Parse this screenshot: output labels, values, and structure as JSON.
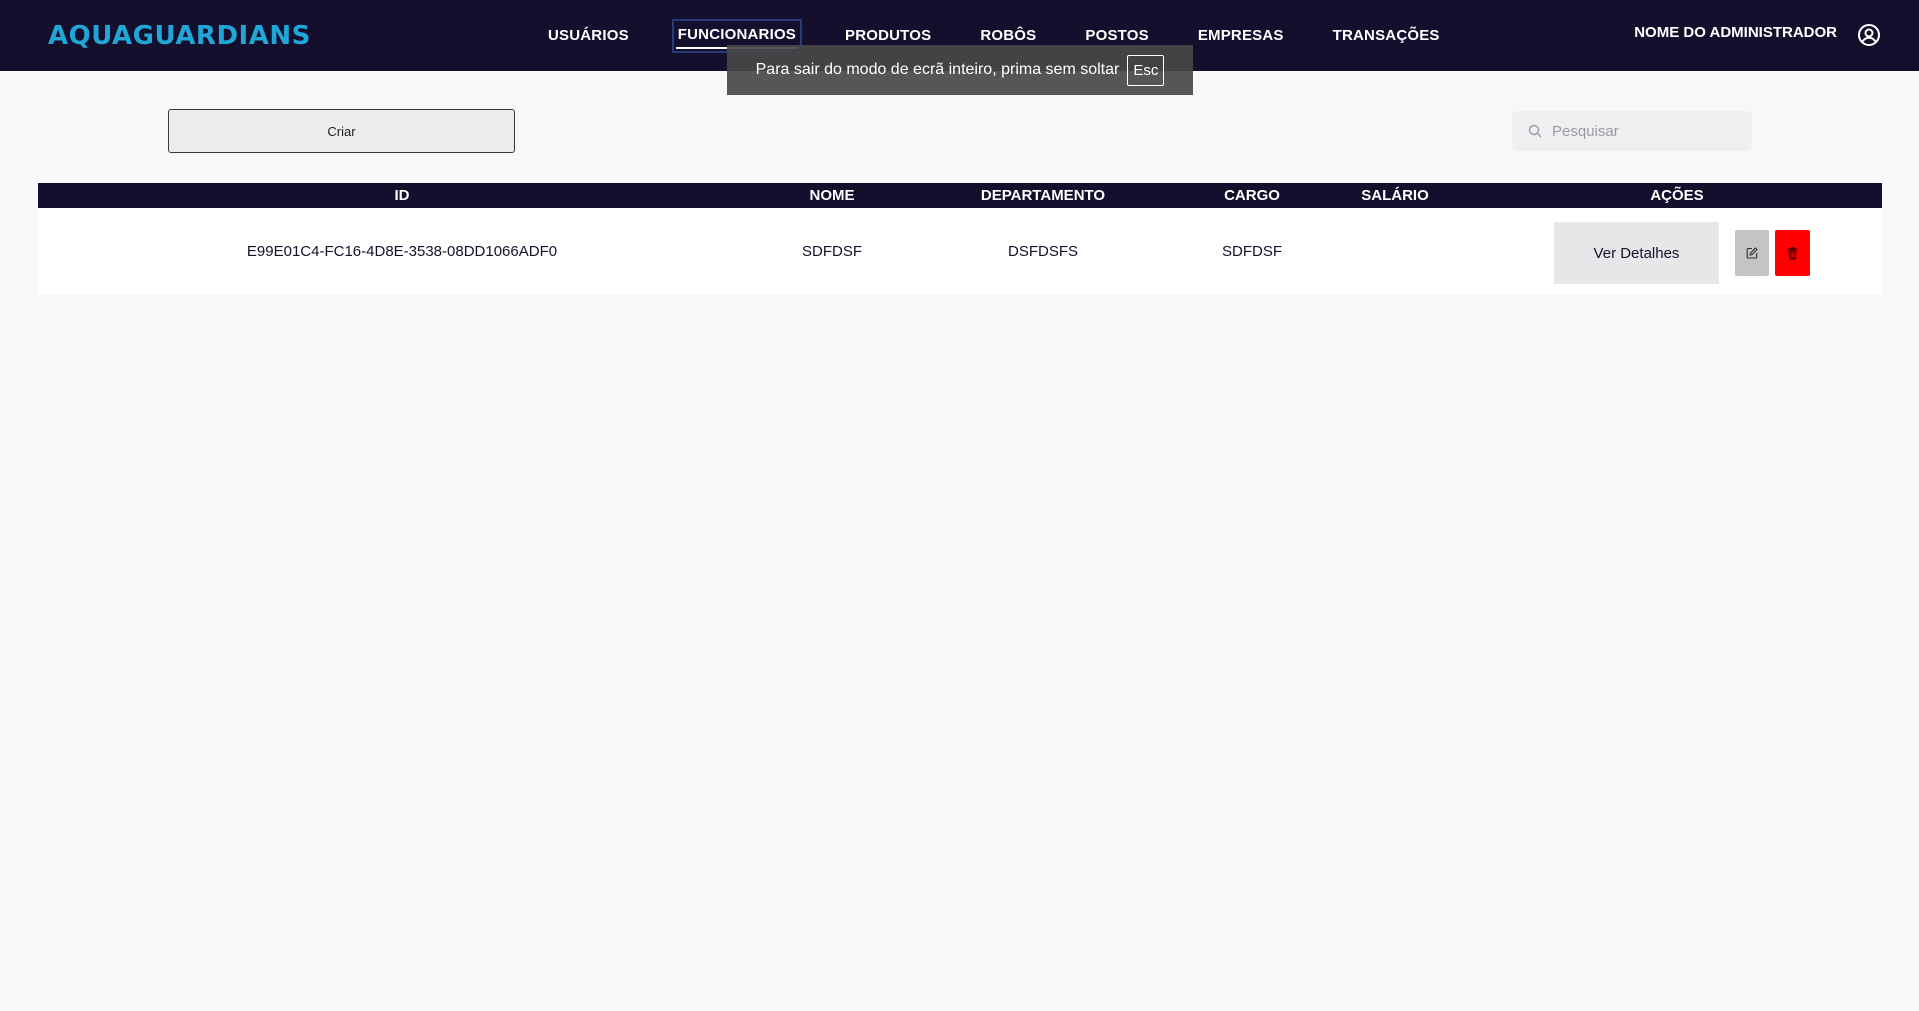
{
  "brand": {
    "name": "AQUAGUARDIANS",
    "color": "#20a7d8"
  },
  "nav": {
    "items": [
      {
        "label": "USUÁRIOS"
      },
      {
        "label": "FUNCIONARIOS"
      },
      {
        "label": "PRODUTOS"
      },
      {
        "label": "ROBÔS"
      },
      {
        "label": "POSTOS"
      },
      {
        "label": "EMPRESAS"
      },
      {
        "label": "TRANSAÇÕES"
      }
    ],
    "active": "FUNCIONARIOS"
  },
  "user": {
    "name": "NOME DO ADMINISTRADOR",
    "icon": "user-circle-icon"
  },
  "toast": {
    "message": "Para sair do modo de ecrã inteiro, prima sem soltar",
    "key": "Esc"
  },
  "toolbar": {
    "create_label": "Criar",
    "search_placeholder": "Pesquisar",
    "search_icon": "search-icon"
  },
  "table": {
    "columns": [
      "ID",
      "NOME",
      "DEPARTAMENTO",
      "CARGO",
      "SALÁRIO",
      "AÇÕES"
    ],
    "rows": [
      {
        "id": "E99E01C4-FC16-4D8E-3538-08DD1066ADF0",
        "nome": "SDFDSF",
        "departamento": "DSFDSFS",
        "cargo": "SDFDSF",
        "salario": "",
        "actions": {
          "details_label": "Ver Detalhes",
          "edit_icon": "edit-icon",
          "delete_icon": "trash-icon"
        }
      }
    ]
  },
  "colors": {
    "header_bg": "#150f2e",
    "delete": "#ff0000",
    "edit": "#c4c4c6"
  }
}
